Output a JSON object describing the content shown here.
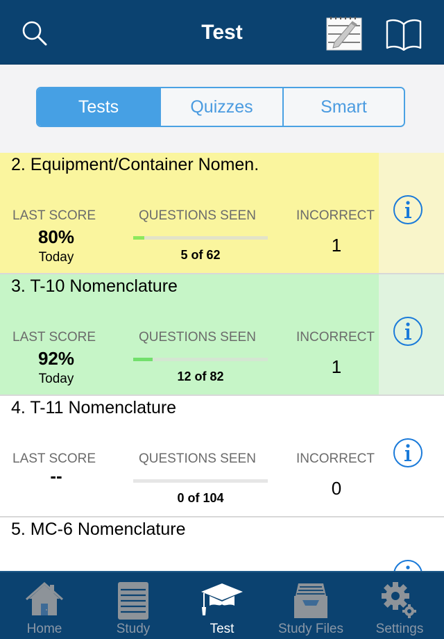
{
  "header": {
    "title": "Test",
    "icons": [
      "search-icon",
      "notepad-pencil-icon",
      "book-icon"
    ]
  },
  "segments": {
    "active": 0,
    "items": [
      {
        "label": "Tests"
      },
      {
        "label": "Quizzes"
      },
      {
        "label": "Smart"
      }
    ]
  },
  "columns": {
    "last_score": "LAST SCORE",
    "questions_seen": "QUESTIONS SEEN",
    "incorrect": "INCORRECT"
  },
  "tests": [
    {
      "title": "2. Equipment/Container Nomen.",
      "highlight": "yellow",
      "last_score": "80%",
      "last_score_when": "Today",
      "seen": 5,
      "total": 62,
      "seen_text": "5 of 62",
      "incorrect": "1"
    },
    {
      "title": "3. T-10 Nomenclature",
      "highlight": "green",
      "last_score": "92%",
      "last_score_when": "Today",
      "seen": 12,
      "total": 82,
      "seen_text": "12 of 82",
      "incorrect": "1"
    },
    {
      "title": "4. T-11 Nomenclature",
      "highlight": "white",
      "last_score": "--",
      "last_score_when": "",
      "seen": 0,
      "total": 104,
      "seen_text": "0 of 104",
      "incorrect": "0"
    },
    {
      "title": "5. MC-6 Nomenclature",
      "highlight": "white",
      "last_score": "",
      "last_score_when": "",
      "seen_text": "",
      "incorrect": ""
    }
  ],
  "tabbar": {
    "active": 2,
    "items": [
      {
        "label": "Home",
        "icon": "home-icon"
      },
      {
        "label": "Study",
        "icon": "notepad-icon"
      },
      {
        "label": "Test",
        "icon": "graduation-cap-icon"
      },
      {
        "label": "Study Files",
        "icon": "file-tray-icon"
      },
      {
        "label": "Settings",
        "icon": "gears-icon"
      }
    ]
  },
  "colors": {
    "nav_bg": "#0b4270",
    "accent": "#46a0e4",
    "row_yellow": "#faf59e",
    "row_green": "#c6f5c7",
    "progress_fill": "#8de85c",
    "info_blue": "#1a7ad9"
  }
}
